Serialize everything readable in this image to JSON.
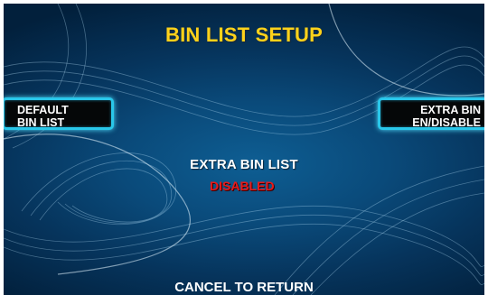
{
  "screen": {
    "title": "BIN LIST SETUP",
    "left_key": {
      "line1": "DEFAULT",
      "line2": "BIN LIST"
    },
    "right_key": {
      "line1": "EXTRA BIN",
      "line2": "EN/DISABLE"
    },
    "info_label": "EXTRA BIN LIST",
    "status": "DISABLED",
    "footer": "CANCEL TO RETURN"
  },
  "colors": {
    "title": "#ffd21a",
    "status": "#e81a1a",
    "key_border": "#29c7ea",
    "background": "#0a4a7a"
  }
}
